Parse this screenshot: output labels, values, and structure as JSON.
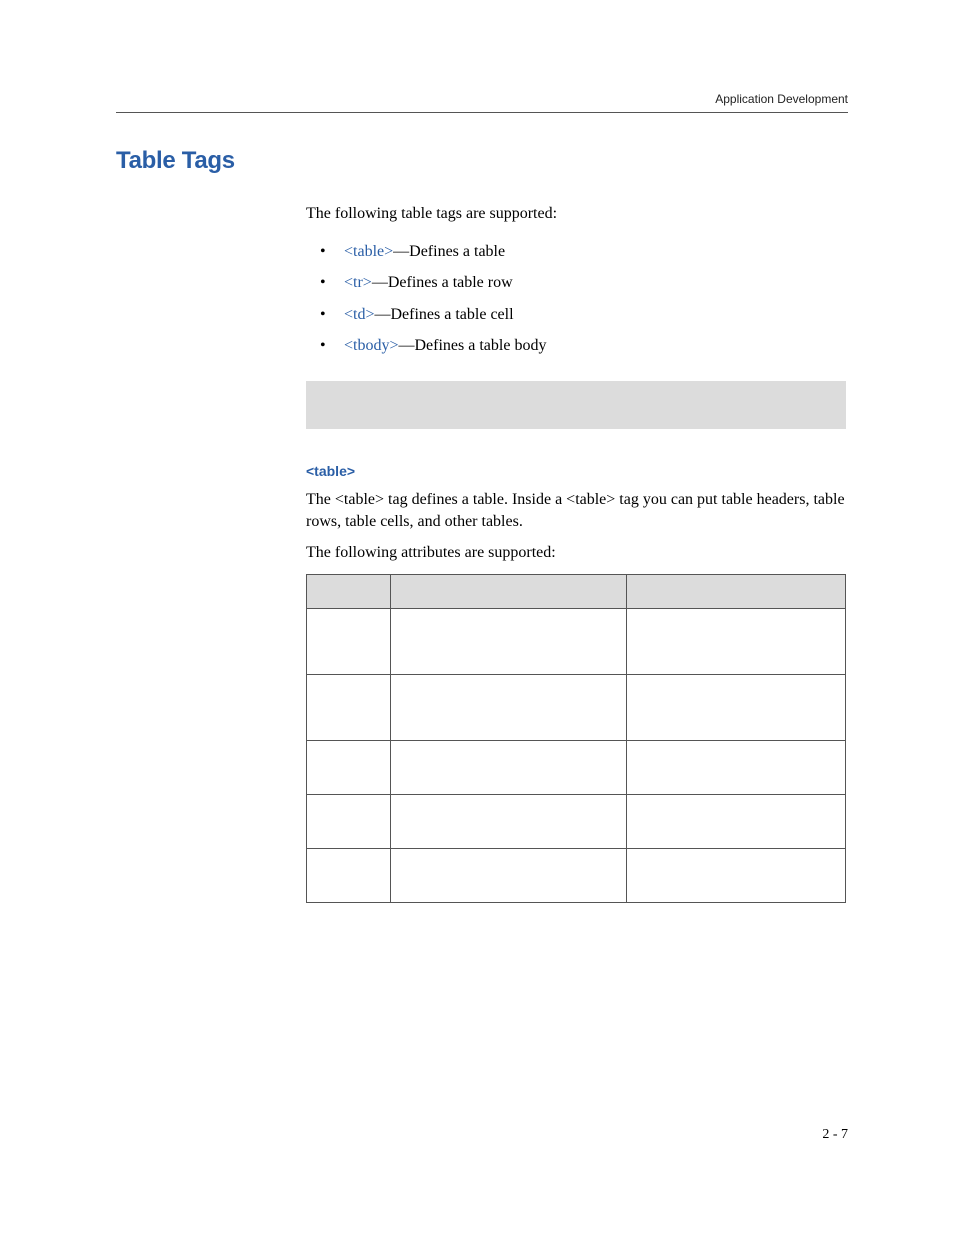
{
  "header": {
    "running_head": "Application Development"
  },
  "section": {
    "title": "Table Tags",
    "intro": "The following table tags are supported:",
    "tags": [
      {
        "link": "<table>",
        "desc": "—Defines a table"
      },
      {
        "link": "<tr>",
        "desc": "—Defines a table row"
      },
      {
        "link": "<td>",
        "desc": "—Defines a table cell"
      },
      {
        "link": "<tbody>",
        "desc": "—Defines a table body"
      }
    ]
  },
  "table_section": {
    "heading": "<table>",
    "para1": "The <table> tag defines a table. Inside a <table> tag you can put table headers, table rows, table cells, and other tables.",
    "para2": "The following attributes are supported:",
    "columns": [
      "",
      "",
      ""
    ],
    "rows": [
      [
        "",
        "",
        ""
      ],
      [
        "",
        "",
        ""
      ],
      [
        "",
        "",
        ""
      ],
      [
        "",
        "",
        ""
      ],
      [
        "",
        "",
        ""
      ]
    ]
  },
  "footer": {
    "page_number": "2 - 7"
  }
}
